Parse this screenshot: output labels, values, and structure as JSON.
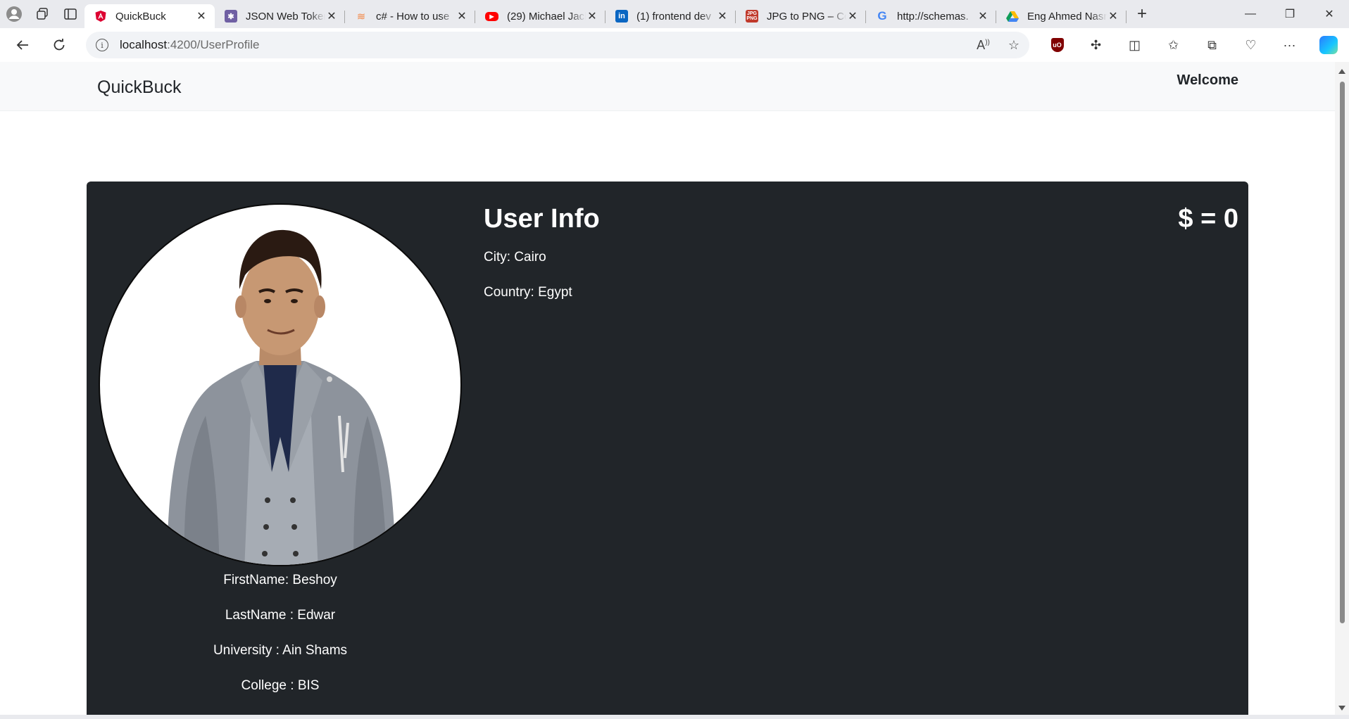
{
  "browser": {
    "tabs": [
      {
        "title": "QuickBuck",
        "active": true,
        "favicon": "angular-icon",
        "color": "#dd0031"
      },
      {
        "title": "JSON Web Tokens",
        "active": false,
        "favicon": "jwt-icon",
        "color": "#6f5fa3"
      },
      {
        "title": "c# - How to use",
        "active": false,
        "favicon": "stackoverflow-icon",
        "color": "#f0a070"
      },
      {
        "title": "(29) Michael Jackson",
        "active": false,
        "favicon": "youtube-icon",
        "color": "#ff0000"
      },
      {
        "title": "(1) frontend dev",
        "active": false,
        "favicon": "linkedin-icon",
        "color": "#0a66c2"
      },
      {
        "title": "JPG to PNG – Convert",
        "active": false,
        "favicon": "jpg-png-icon",
        "color": "#c0392b"
      },
      {
        "title": "http://schemas.",
        "active": false,
        "favicon": "google-icon",
        "color": "#4285f4"
      },
      {
        "title": "Eng Ahmed Nasr",
        "active": false,
        "favicon": "google-drive-icon",
        "color": "#0f9d58"
      }
    ],
    "url_host": "localhost",
    "url_path": ":4200/UserProfile"
  },
  "app": {
    "brand": "QuickBuck",
    "welcome": "Welcome"
  },
  "profile": {
    "first_name": "FirstName: Beshoy",
    "last_name": "LastName : Edwar",
    "university": "University : Ain Shams",
    "college": "College : BIS",
    "info_title": "User Info",
    "city": "City: Cairo",
    "country": "Country: Egypt",
    "balance": "$ = 0"
  }
}
